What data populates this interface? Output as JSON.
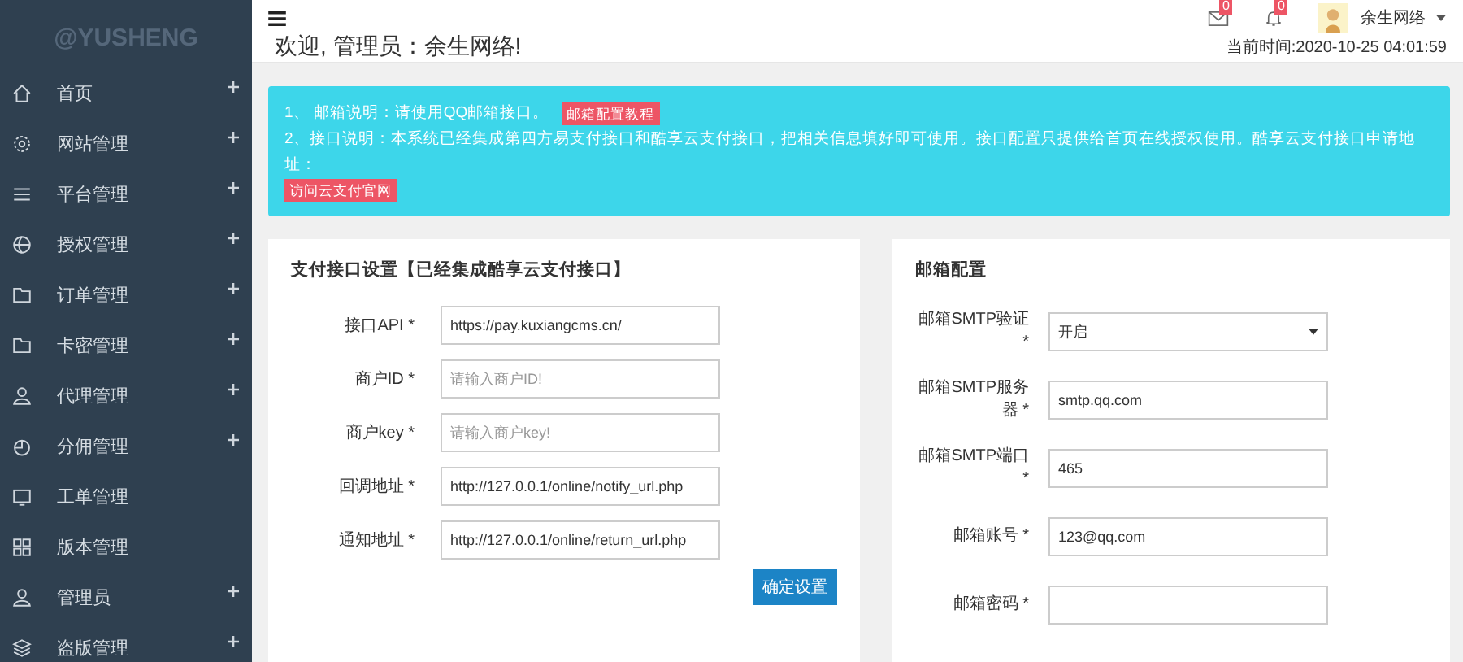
{
  "sidebar": {
    "logo": "@YUSHENG",
    "items": [
      {
        "label": "首页",
        "expandable": true
      },
      {
        "label": "网站管理",
        "expandable": true
      },
      {
        "label": "平台管理",
        "expandable": true
      },
      {
        "label": "授权管理",
        "expandable": true
      },
      {
        "label": "订单管理",
        "expandable": true
      },
      {
        "label": "卡密管理",
        "expandable": true
      },
      {
        "label": "代理管理",
        "expandable": true
      },
      {
        "label": "分佣管理",
        "expandable": true
      },
      {
        "label": "工单管理",
        "expandable": false
      },
      {
        "label": "版本管理",
        "expandable": false
      },
      {
        "label": "管理员",
        "expandable": true
      },
      {
        "label": "盗版管理",
        "expandable": true
      }
    ]
  },
  "topbar": {
    "mail_count": "0",
    "bell_count": "0",
    "user": "余生网络"
  },
  "welcome": "欢迎, 管理员：余生网络!",
  "time": "当前时间:2020-10-25 04:01:59",
  "notice": [
    {
      "text": "1、 邮箱说明：请使用QQ邮箱接口。",
      "tag": "邮箱配置教程"
    },
    {
      "text": "2、接口说明：本系统已经集成第四方易支付接口和酷享云支付接口，把相关信息填好即可使用。接口配置只提供给首页在线授权使用。酷享云支付接口申请地址：",
      "tag": "访问云支付官网"
    }
  ],
  "pay_panel": {
    "title": "支付接口设置【已经集成酷享云支付接口】",
    "fields": [
      {
        "label": "接口API *",
        "value": "https://pay.kuxiangcms.cn/"
      },
      {
        "label": "商户ID *",
        "placeholder": "请输入商户ID!"
      },
      {
        "label": "商户key *",
        "placeholder": "请输入商户key!"
      },
      {
        "label": "回调地址 *",
        "value": "http://127.0.0.1/online/notify_url.php"
      },
      {
        "label": "通知地址 *",
        "value": "http://127.0.0.1/online/return_url.php"
      }
    ],
    "button": "确定设置"
  },
  "mail_panel": {
    "title": "邮箱配置",
    "fields": [
      {
        "kind": "select",
        "label": "邮箱SMTP验证 *",
        "value": "开启"
      },
      {
        "kind": "input",
        "label": "邮箱SMTP服务器 *",
        "value": "smtp.qq.com"
      },
      {
        "kind": "input",
        "label": "邮箱SMTP端口 *",
        "value": "465"
      },
      {
        "kind": "input",
        "label": "邮箱账号 *",
        "value": "123@qq.com"
      },
      {
        "kind": "input",
        "label": "邮箱密码 *"
      }
    ]
  }
}
